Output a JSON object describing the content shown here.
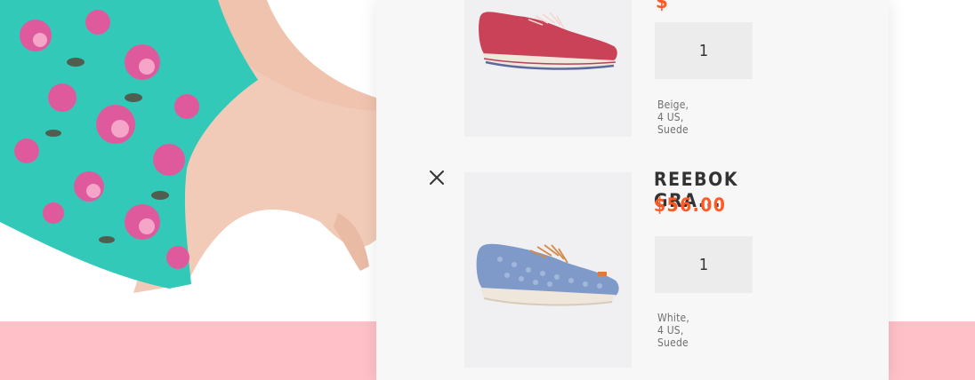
{
  "colors": {
    "accent": "#ff5a26",
    "panel_bg": "#f7f7f8",
    "image_bg": "#f0f0f2",
    "qty_bg": "#ececed",
    "band_pink": "#ffc0c7"
  },
  "cart": {
    "items": [
      {
        "name": "",
        "price": "$",
        "quantity": "1",
        "variant": "Beige, 4 US, Suede",
        "image_icon": "red-sneaker-image"
      },
      {
        "name": "REEBOK GRA...",
        "price": "$56.00",
        "quantity": "1",
        "variant": "White, 4 US, Suede",
        "image_icon": "blue-sneaker-image",
        "remove_icon": "close-icon"
      }
    ]
  }
}
